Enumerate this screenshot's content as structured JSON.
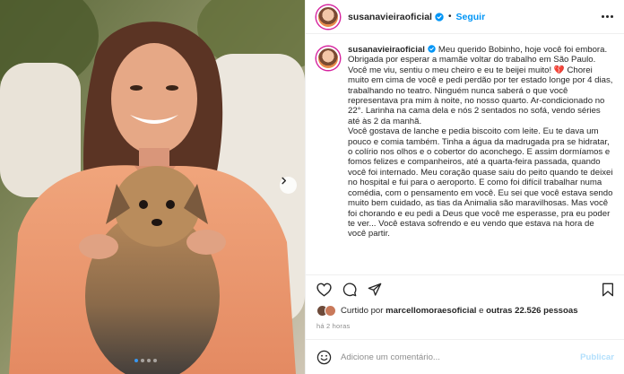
{
  "header": {
    "username": "susanavieiraoficial",
    "separator": "•",
    "follow_label": "Seguir"
  },
  "caption": {
    "username": "susanavieiraoficial",
    "paragraph_1": "Meu querido Bobinho, hoje você foi embora. Obrigada por esperar a mamãe voltar do trabalho em São Paulo. Você me viu, sentiu o meu cheiro e eu te beijei muito! 💔 Chorei muito em cima de você e pedi perdão por ter estado longe por 4 dias, trabalhando no teatro. Ninguém nunca saberá o que você representava pra mim à noite, no nosso quarto. Ar-condicionado no 22°. Larinha na cama dela e nós 2 sentados no sofá, vendo séries até às 2 da manhã.",
    "paragraph_2": "Você gostava de lanche e pedia biscoito com leite. Eu te dava um pouco e comia também. Tinha a água da madrugada pra se hidratar, o colírio nos olhos e o cobertor do aconchego. E assim dormíamos e fomos felizes e companheiros, até a quarta-feira passada, quando você foi internado. Meu coração quase saiu do peito quando te deixei no hospital e fui para o aeroporto. E como foi difícil trabalhar numa comédia, com o pensamento em você. Eu sei que você estava sendo muito bem cuidado, as tias da Animalia são maravilhosas. Mas você foi chorando e eu pedi a Deus que você me esperasse, pra eu poder te ver... Você estava sofrendo e eu vendo que estava na hora de você partir."
  },
  "likes": {
    "prefix": "Curtido por",
    "user": "marcellomoraesoficial",
    "middle": "e",
    "others": "outras 22.526 pessoas"
  },
  "timestamp": "há 2 horas",
  "comment": {
    "placeholder": "Adicione um comentário...",
    "publish_label": "Publicar"
  },
  "carousel": {
    "slides": 4,
    "active_index": 0
  },
  "icons": {
    "verified": "verified-badge-icon",
    "more": "more-options-icon",
    "like": "heart-icon",
    "comment": "comment-icon",
    "share": "share-icon",
    "save": "bookmark-icon",
    "emoji": "emoji-icon",
    "next": "chevron-right-icon"
  },
  "colors": {
    "accent": "#0095f6",
    "verified": "#0095f6",
    "publish_disabled": "#b2dffc",
    "muted_text": "#8e8e8e",
    "heartbreak": "#e0245e"
  }
}
